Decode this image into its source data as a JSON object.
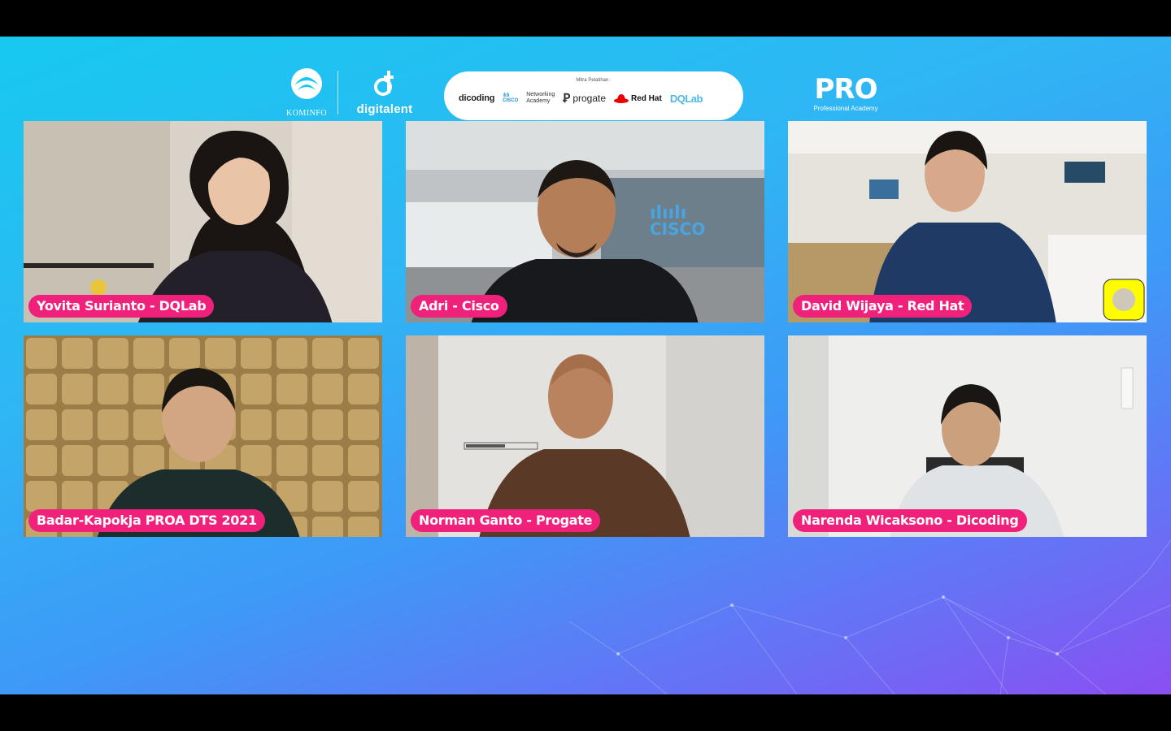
{
  "header": {
    "kominfo_label": "KOMINFO",
    "digitalent_label": "digitalent",
    "partners": {
      "caption": "Mitra Pelatihan :",
      "dicoding": "dicoding",
      "cisco_word": "CISCO",
      "networking_line1": "Networking",
      "networking_line2": "Academy",
      "progate": "progate",
      "redhat": "Red Hat",
      "dqlab": "DQLab"
    },
    "pro_label": "PRO",
    "pro_sub": "Professional Academy"
  },
  "participants": [
    {
      "name": "Yovita Surianto - DQLab"
    },
    {
      "name": "Adri - Cisco"
    },
    {
      "name": "David Wijaya - Red Hat"
    },
    {
      "name": "Badar-Kapokja PROA DTS 2021"
    },
    {
      "name": "Norman Ganto - Progate"
    },
    {
      "name": "Narenda Wicaksono - Dicoding"
    }
  ],
  "colors": {
    "name_tag": "#f0217a",
    "bg_start": "#17c9ef",
    "bg_end": "#8a4ff2"
  }
}
